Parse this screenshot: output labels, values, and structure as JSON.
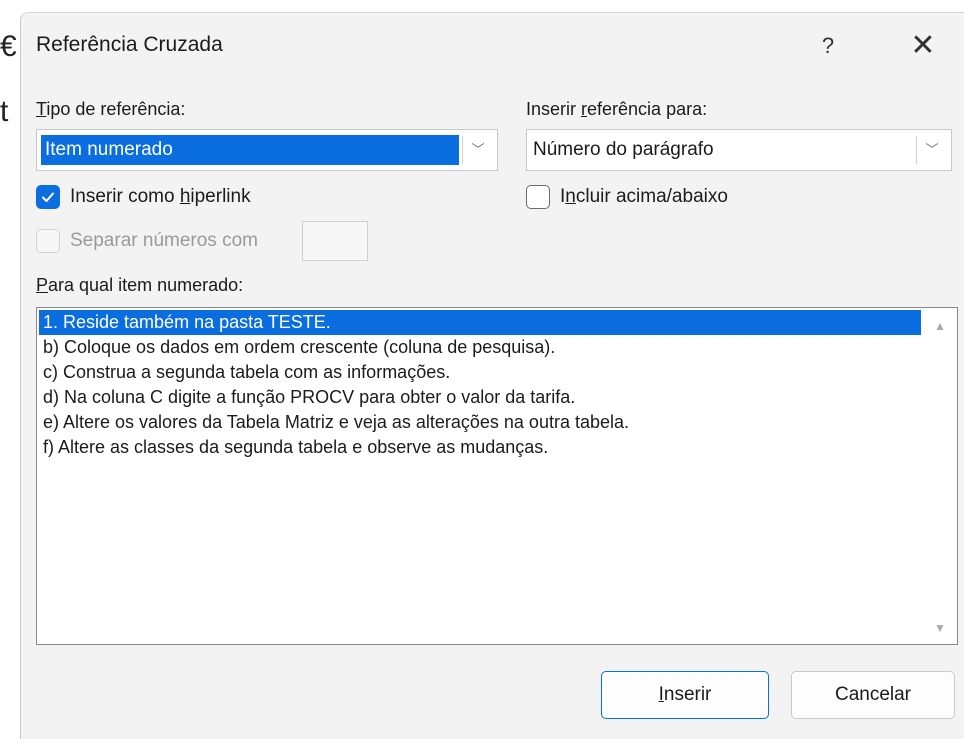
{
  "background_text": {
    "line1": "€",
    "line2": "t"
  },
  "dialog": {
    "title": "Referência Cruzada",
    "help_label": "?",
    "close_label": "✕"
  },
  "reference_type": {
    "label_first": "T",
    "label_rest": "ipo de referência:",
    "value": "Item numerado"
  },
  "insert_reference_for": {
    "label_before": "Inserir ",
    "label_underlined": "r",
    "label_after": "eferência para:",
    "value": "Número do parágrafo"
  },
  "hyperlink_checkbox": {
    "label_before": "Inserir como ",
    "label_underlined": "h",
    "label_after": "iperlink",
    "checked": true
  },
  "include_above_below": {
    "label_before": "I",
    "label_underlined": "n",
    "label_after": "cluir acima/abaixo",
    "checked": false
  },
  "separate_numbers": {
    "label": "Separar números com",
    "checked": false,
    "enabled": false
  },
  "items_section": {
    "label_first": "P",
    "label_rest": "ara qual item numerado:",
    "items": [
      "1. Reside também na pasta TESTE.",
      "b) Coloque os dados em ordem crescente (coluna de pesquisa).",
      "c) Construa a segunda tabela com as informações.",
      "d) Na coluna C digite a função PROCV para obter o valor da tarifa.",
      "e) Altere os valores da Tabela Matriz e veja as alterações na outra tabela.",
      "f) Altere as classes da segunda tabela e observe as mudanças."
    ],
    "selected_index": 0
  },
  "buttons": {
    "insert_first": "I",
    "insert_rest": "nserir",
    "cancel": "Cancelar"
  },
  "colors": {
    "accent": "#0a6ee0",
    "dialog_bg": "#f3f3f3"
  }
}
